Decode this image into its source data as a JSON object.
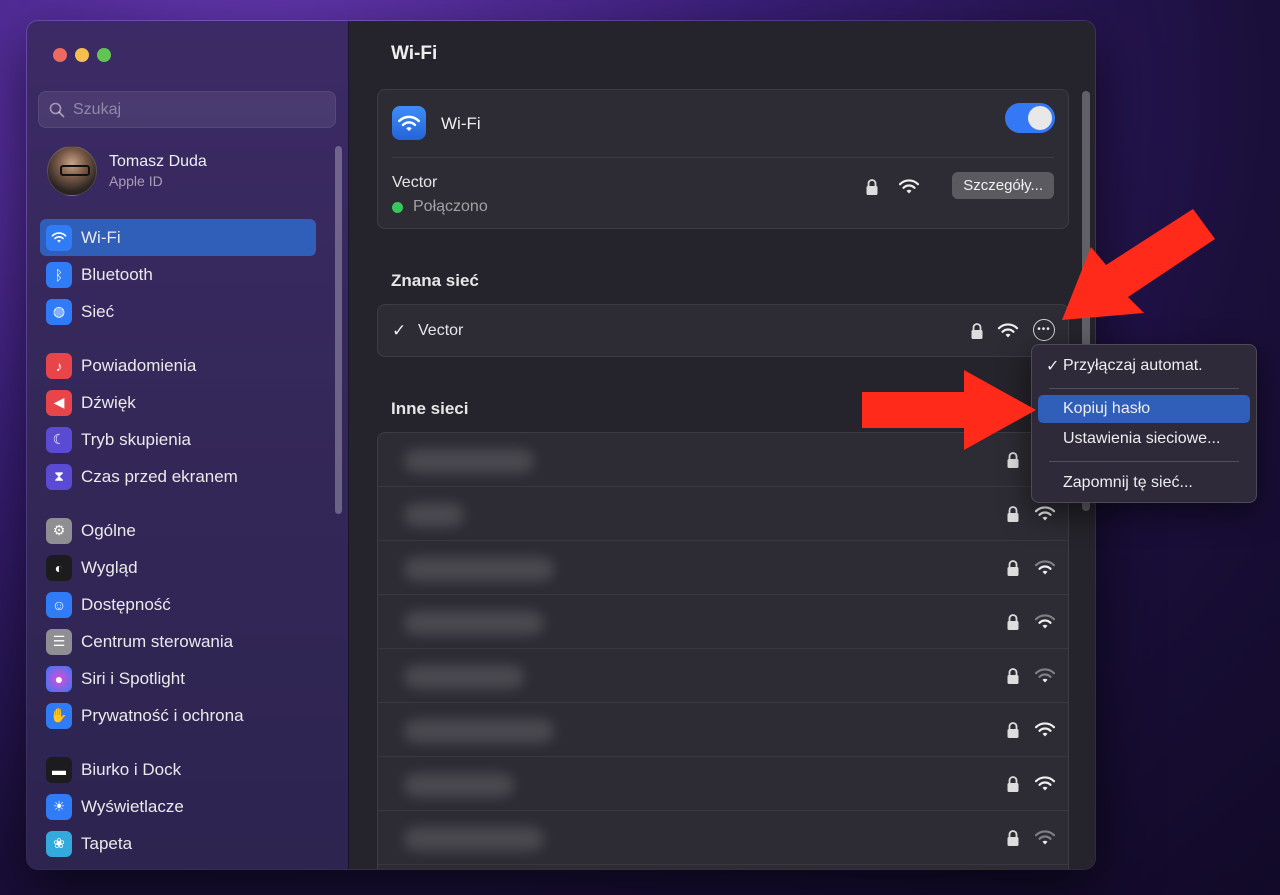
{
  "search": {
    "placeholder": "Szukaj"
  },
  "user": {
    "name": "Tomasz Duda",
    "subtitle": "Apple ID"
  },
  "sidebar": {
    "items": [
      {
        "label": "Wi-Fi",
        "icon": "wifi-icon",
        "color": "#2f7cf6"
      },
      {
        "label": "Bluetooth",
        "icon": "bluetooth-icon",
        "color": "#2f7cf6"
      },
      {
        "label": "Sieć",
        "icon": "globe-icon",
        "color": "#2f7cf6"
      },
      {
        "label": "Powiadomienia",
        "icon": "bell-icon",
        "color": "#e8454a"
      },
      {
        "label": "Dźwięk",
        "icon": "speaker-icon",
        "color": "#e8454a"
      },
      {
        "label": "Tryb skupienia",
        "icon": "moon-icon",
        "color": "#5b4bd4"
      },
      {
        "label": "Czas przed ekranem",
        "icon": "hourglass-icon",
        "color": "#5b4bd4"
      },
      {
        "label": "Ogólne",
        "icon": "gear-icon",
        "color": "#8e8e93"
      },
      {
        "label": "Wygląd",
        "icon": "appearance-icon",
        "color": "#1c1c1e"
      },
      {
        "label": "Dostępność",
        "icon": "accessibility-icon",
        "color": "#2f7cf6"
      },
      {
        "label": "Centrum sterowania",
        "icon": "toggles-icon",
        "color": "#8e8e93"
      },
      {
        "label": "Siri i Spotlight",
        "icon": "siri-icon",
        "color": "#a23fd6"
      },
      {
        "label": "Prywatność i ochrona",
        "icon": "hand-icon",
        "color": "#2f7cf6"
      },
      {
        "label": "Biurko i Dock",
        "icon": "dock-icon",
        "color": "#1c1c1e"
      },
      {
        "label": "Wyświetlacze",
        "icon": "sun-icon",
        "color": "#2f7cf6"
      },
      {
        "label": "Tapeta",
        "icon": "flower-icon",
        "color": "#34aadc"
      }
    ]
  },
  "main": {
    "title": "Wi-Fi",
    "wifi_toggle_label": "Wi-Fi",
    "wifi_enabled": true,
    "current_network": {
      "name": "Vector",
      "status": "Połączono",
      "details_label": "Szczegóły..."
    },
    "known_section_title": "Znana sieć",
    "known_network": {
      "check": "✓",
      "name": "Vector"
    },
    "other_section_title": "Inne sieci"
  },
  "context_menu": {
    "auto_join": "Przyłączaj automat.",
    "auto_join_check": "✓",
    "copy_password": "Kopiuj hasło",
    "network_settings": "Ustawienia sieciowe...",
    "forget": "Zapomnij tę sieć..."
  },
  "colors": {
    "accent": "#2f5fb8",
    "arrow": "#ff2a1a"
  }
}
